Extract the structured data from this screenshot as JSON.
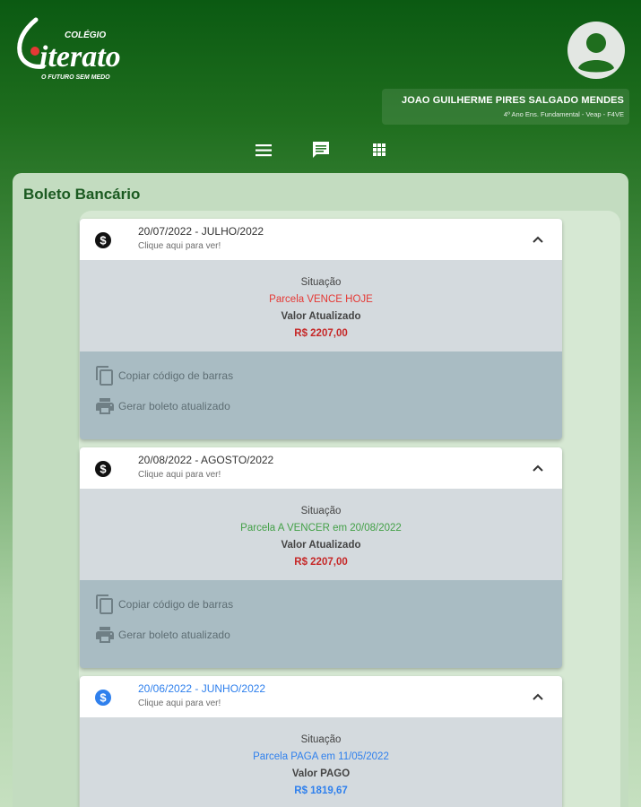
{
  "app": {
    "logo_text_top": "COLÉGIO",
    "logo_text_main": "Literato",
    "logo_tagline": "O FUTURO SEM MEDO"
  },
  "user": {
    "name": "JOAO GUILHERME PIRES SALGADO MENDES",
    "info": "4º Ano Ens. Fundamental - Veap - F4VE"
  },
  "nav": {
    "icons": [
      "menu-icon",
      "chat-icon",
      "apps-grid-icon"
    ]
  },
  "page": {
    "title": "Boleto Bancário"
  },
  "cards": [
    {
      "date": "20/07/2022 - JULHO/2022",
      "subtitle": "Clique aqui para ver!",
      "situacao_label": "Situação",
      "status": "Parcela VENCE HOJE",
      "valor_label": "Valor Atualizado",
      "valor": "R$ 2207,00",
      "action_copy": "Copiar código de barras",
      "action_print": "Gerar boleto atualizado"
    },
    {
      "date": "20/08/2022 - AGOSTO/2022",
      "subtitle": "Clique aqui para ver!",
      "situacao_label": "Situação",
      "status": "Parcela A VENCER em 20/08/2022",
      "valor_label": "Valor Atualizado",
      "valor": "R$ 2207,00",
      "action_copy": "Copiar código de barras",
      "action_print": "Gerar boleto atualizado"
    },
    {
      "date": "20/06/2022 - JUNHO/2022",
      "subtitle": "Clique aqui para ver!",
      "situacao_label": "Situação",
      "status": "Parcela PAGA em 11/05/2022",
      "valor_label": "Valor PAGO",
      "valor": "R$ 1819,67"
    }
  ],
  "colors": {
    "status_due_today": "#e53935",
    "status_upcoming": "#43a047",
    "status_paid": "#2f80ed",
    "value_red": "#c62828",
    "title_green": "#1b5a21"
  }
}
